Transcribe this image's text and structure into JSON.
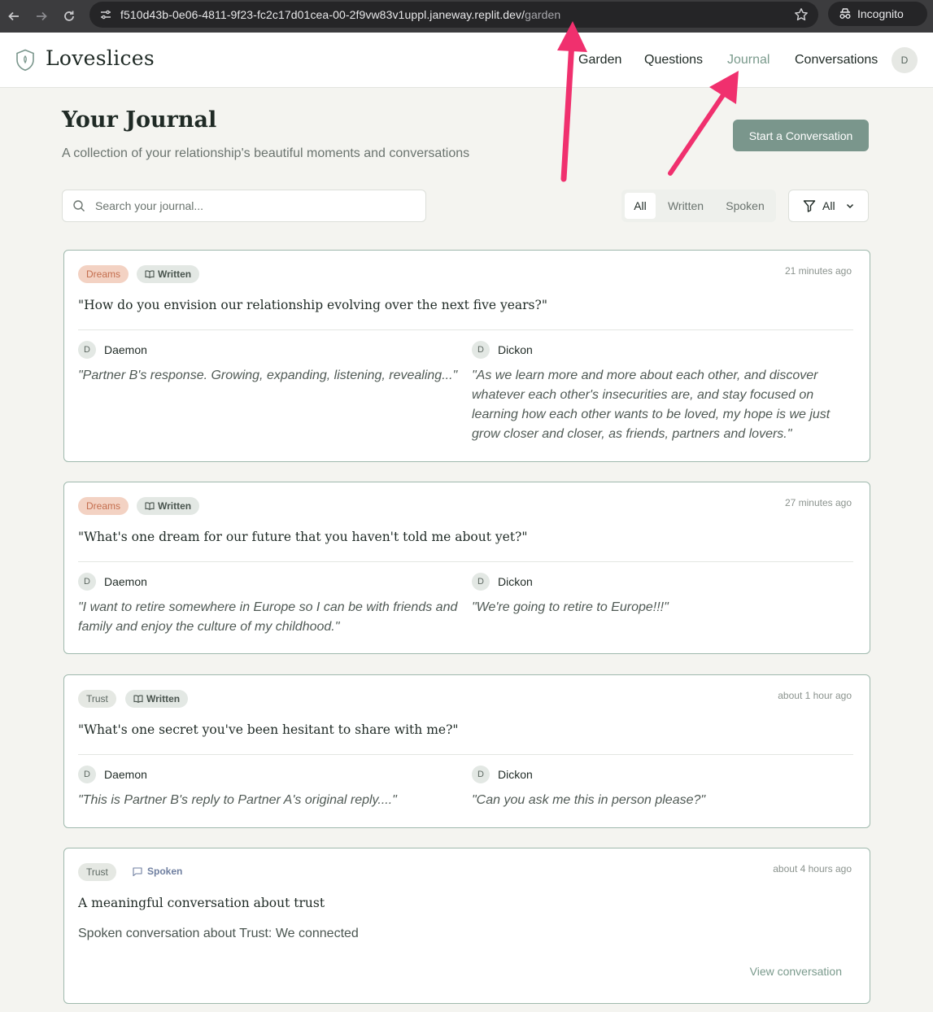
{
  "browser": {
    "url_host": "f510d43b-0e06-4811-9f23-fc2c17d01cea-00-2f9vw83v1uppl.janeway.replit.dev/",
    "url_path": "garden",
    "incognito_label": "Incognito"
  },
  "header": {
    "brand": "Loveslices",
    "nav": [
      "Garden",
      "Questions",
      "Journal",
      "Conversations"
    ],
    "active_nav": "Journal",
    "avatar_initial": "D"
  },
  "page": {
    "title": "Your Journal",
    "subtitle": "A collection of your relationship's beautiful moments and conversations",
    "start_button": "Start a Conversation",
    "search_placeholder": "Search your journal...",
    "segments": [
      "All",
      "Written",
      "Spoken"
    ],
    "active_segment": "All",
    "filter_label": "All"
  },
  "entries": [
    {
      "category": "Dreams",
      "type": "Written",
      "time": "21 minutes ago",
      "question": "\"How do you envision our relationship evolving over the next five years?\"",
      "a_initial": "D",
      "a_name": "Daemon",
      "a_reply": "\"Partner B's response. Growing, expanding, listening, revealing...\"",
      "b_initial": "D",
      "b_name": "Dickon",
      "b_reply": "\"As we learn more and more about each other, and discover whatever each other's insecurities are, and stay focused on learning how each other wants to be loved, my hope is we just grow closer and closer, as friends, partners and lovers.\""
    },
    {
      "category": "Dreams",
      "type": "Written",
      "time": "27 minutes ago",
      "question": "\"What's one dream for our future that you haven't told me about yet?\"",
      "a_initial": "D",
      "a_name": "Daemon",
      "a_reply": "\"I want to retire somewhere in Europe so I can be with friends and family and enjoy the culture of my childhood.\"",
      "b_initial": "D",
      "b_name": "Dickon",
      "b_reply": "\"We're going to retire to Europe!!!\""
    },
    {
      "category": "Trust",
      "type": "Written",
      "time": "about 1 hour ago",
      "question": "\"What's one secret you've been hesitant to share with me?\"",
      "a_initial": "D",
      "a_name": "Daemon",
      "a_reply": "\"This is Partner B's reply to Partner A's original reply....\"",
      "b_initial": "D",
      "b_name": "Dickon",
      "b_reply": "\"Can you ask me this in person please?\""
    },
    {
      "category": "Trust",
      "type": "Spoken",
      "time": "about 4 hours ago",
      "title": "A meaningful conversation about trust",
      "summary": "Spoken conversation about Trust: We connected",
      "link": "View conversation"
    }
  ],
  "colors": {
    "accent": "#7a968c",
    "active_nav": "#7a9a8c",
    "card_border": "#9fb9ad",
    "dreams_bg": "#f3d2c3",
    "dreams_text": "#c46e4e",
    "annotation_arrow": "#f0306e"
  }
}
